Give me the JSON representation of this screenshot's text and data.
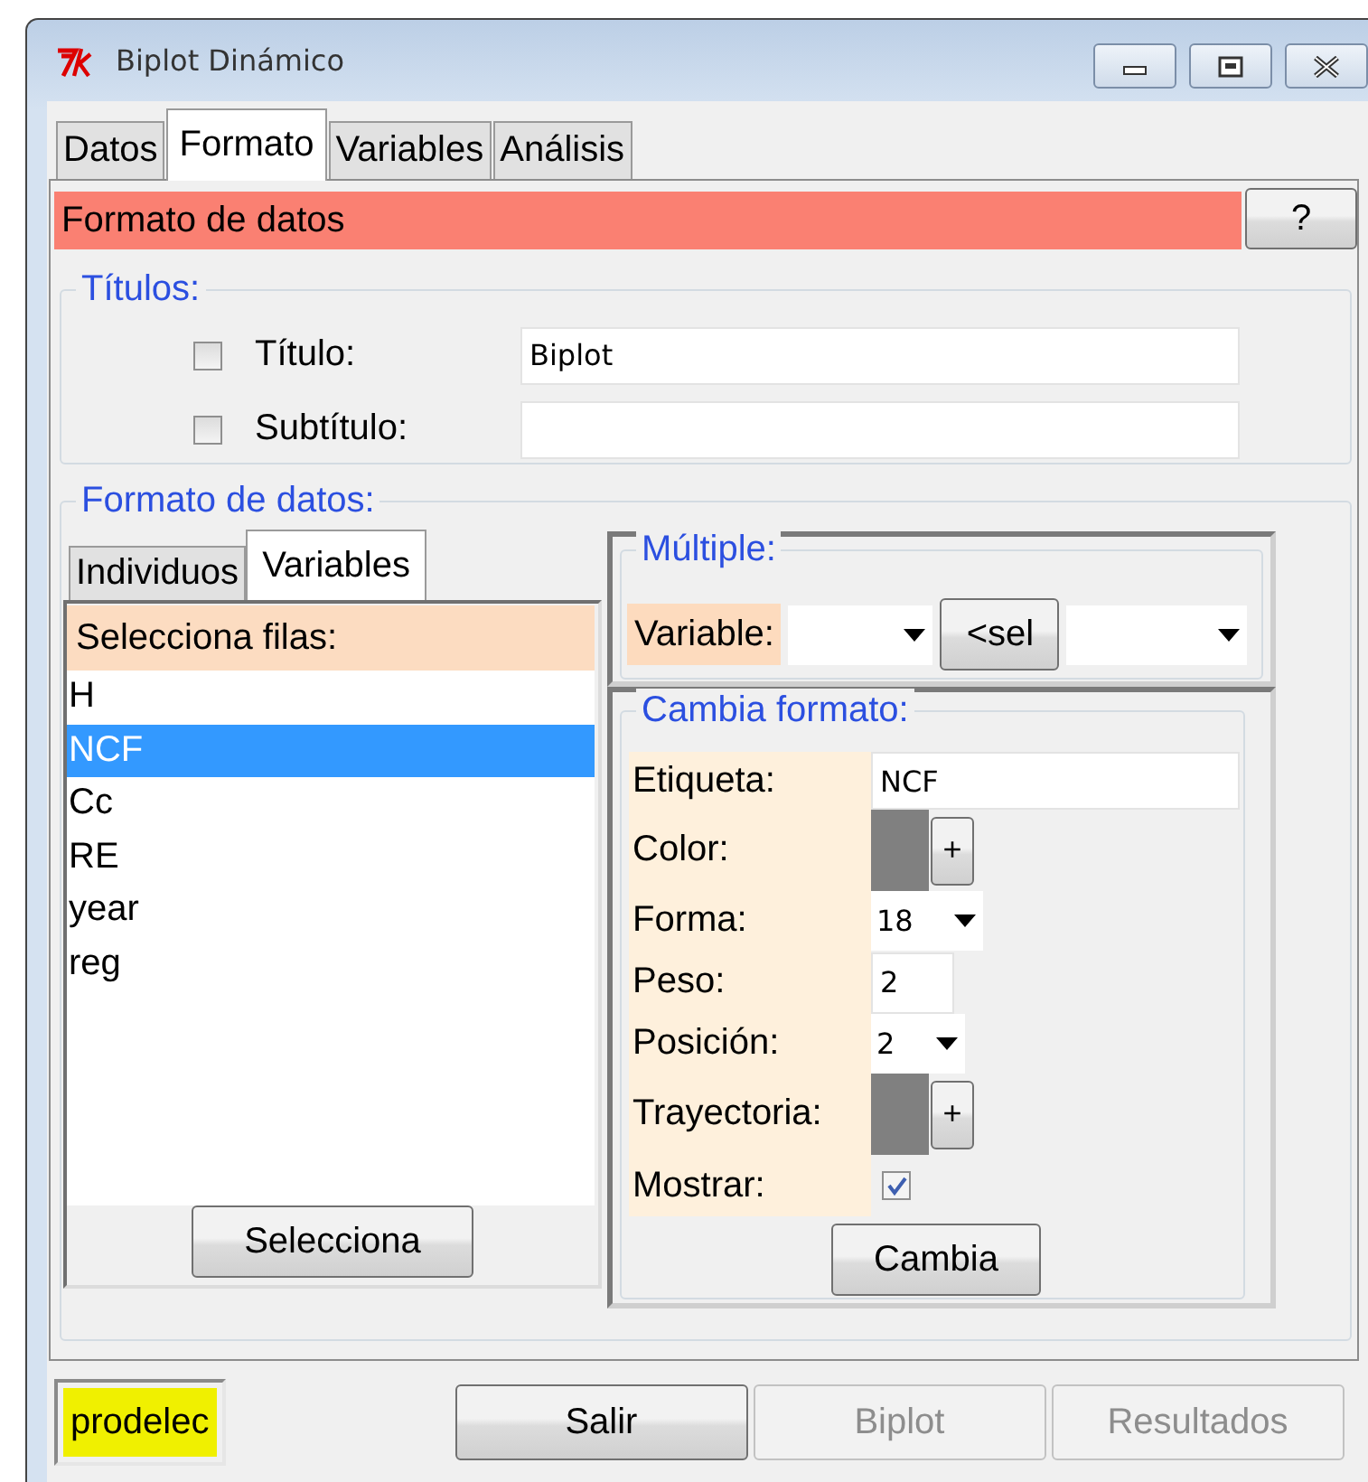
{
  "window": {
    "title": "Biplot Dinámico"
  },
  "tabs": [
    {
      "label": "Datos",
      "selected": false
    },
    {
      "label": "Formato",
      "selected": true
    },
    {
      "label": "Variables",
      "selected": false
    },
    {
      "label": "Análisis",
      "selected": false
    }
  ],
  "header": {
    "title": "Formato de datos",
    "help_button": "?"
  },
  "titles": {
    "legend": "Títulos:",
    "rows": [
      {
        "label": "Título:",
        "checked": false,
        "value": "Biplot"
      },
      {
        "label": "Subtítulo:",
        "checked": false
      }
    ]
  },
  "data_format": {
    "legend": "Formato de datos:",
    "subtabs": [
      {
        "label": "Individuos",
        "selected": false
      },
      {
        "label": "Variables",
        "selected": true
      }
    ],
    "list": {
      "header": "Selecciona filas:",
      "items": [
        {
          "label": "H",
          "selected": false
        },
        {
          "label": "NCF",
          "selected": true
        },
        {
          "label": "Cc",
          "selected": false
        },
        {
          "label": "RE",
          "selected": false
        },
        {
          "label": "year",
          "selected": false
        },
        {
          "label": "reg",
          "selected": false
        }
      ]
    },
    "select_button": "Selecciona",
    "multiple": {
      "legend": "Múltiple:",
      "label": "Variable:",
      "button": "<sel"
    },
    "change_format": {
      "legend": "Cambia formato:",
      "rows": [
        {
          "kind": "text",
          "label": "Etiqueta:",
          "value": "NCF"
        },
        {
          "kind": "color",
          "label": "Color:",
          "color": "#808080",
          "button": "+"
        },
        {
          "kind": "select",
          "label": "Forma:",
          "value": "18"
        },
        {
          "kind": "short",
          "label": "Peso:",
          "value": "2"
        },
        {
          "kind": "select",
          "label": "Posición:",
          "value": "2"
        },
        {
          "kind": "color",
          "label": "Trayectoria:",
          "color": "#808080",
          "button": "+"
        },
        {
          "kind": "check",
          "label": "Mostrar:",
          "checked": true
        }
      ],
      "button": "Cambia"
    }
  },
  "footer": {
    "dataset": "prodelec",
    "buttons": [
      {
        "label": "Salir",
        "disabled": false
      },
      {
        "label": "Biplot",
        "disabled": true
      },
      {
        "label": "Resultados",
        "disabled": true
      }
    ]
  }
}
